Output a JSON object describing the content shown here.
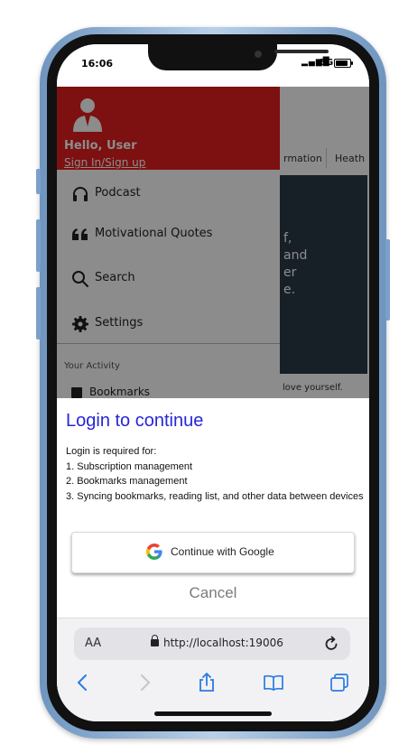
{
  "status_bar": {
    "time": "16:06",
    "signal": "▂▄▆█",
    "network": "5G"
  },
  "background": {
    "tabs": [
      "rmation",
      "Heath"
    ],
    "hero_lines": [
      "f,",
      "and",
      "er",
      "e."
    ],
    "caption": "love yourself."
  },
  "drawer": {
    "greeting": "Hello, User",
    "signin_link": "Sign In/Sign up",
    "items": [
      {
        "label": "Podcast",
        "icon": "headphones-icon"
      },
      {
        "label": "Motivational Quotes",
        "icon": "quote-icon"
      },
      {
        "label": "Search",
        "icon": "search-icon"
      },
      {
        "label": "Settings",
        "icon": "gear-icon"
      }
    ],
    "section_label": "Your Activity",
    "bookmarks_label": "Bookmarks"
  },
  "login_sheet": {
    "title": "Login to continue",
    "intro": "Login is required for:",
    "reasons": [
      "1. Subscription management",
      "2. Bookmarks management",
      "3. Syncing bookmarks, reading list, and other data between devices"
    ],
    "google_button": "Continue with Google",
    "cancel": "Cancel"
  },
  "safari": {
    "aa_label": "AA",
    "url": "http://localhost:19006"
  },
  "colors": {
    "accent": "#e31e1e",
    "title": "#2626d9",
    "toolbar_icons": "#2a7be4"
  }
}
